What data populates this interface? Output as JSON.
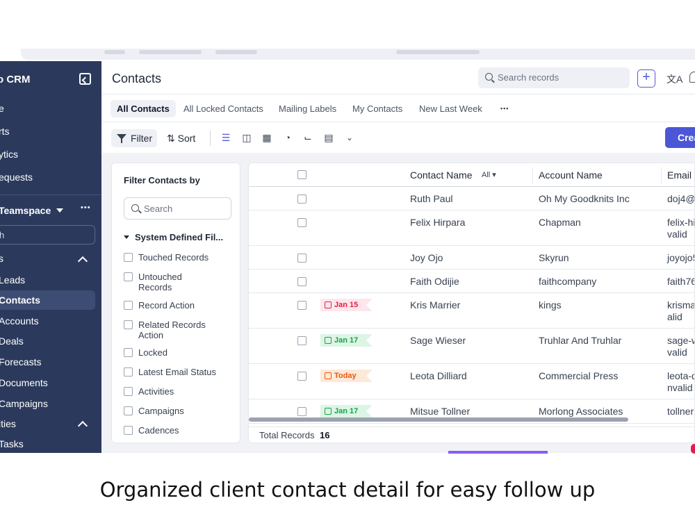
{
  "sidebar": {
    "brand": "o CRM",
    "items": [
      {
        "label": "e"
      },
      {
        "label": "rts"
      },
      {
        "label": "ytics"
      },
      {
        "label": "equests"
      },
      {
        "label": "Teamspace"
      },
      {
        "label": "s"
      },
      {
        "label": "Leads"
      },
      {
        "label": "Contacts"
      },
      {
        "label": "Accounts"
      },
      {
        "label": "Deals"
      },
      {
        "label": "Forecasts"
      },
      {
        "label": "Documents"
      },
      {
        "label": "Campaigns"
      },
      {
        "label": "ities"
      },
      {
        "label": "Tasks"
      }
    ],
    "search_text": "h",
    "more": "•••"
  },
  "header": {
    "title": "Contacts",
    "search_placeholder": "Search records",
    "add_label": "+",
    "translate_label": "文A"
  },
  "tabs": [
    {
      "label": "All Contacts",
      "active": true
    },
    {
      "label": "All Locked Contacts"
    },
    {
      "label": "Mailing Labels"
    },
    {
      "label": "My Contacts"
    },
    {
      "label": "New Last Week"
    }
  ],
  "tabs_more": "•••",
  "toolbar": {
    "filter_label": "Filter",
    "sort_label": "⇅ Sort",
    "create_label": "Crea"
  },
  "filter_panel": {
    "title": "Filter Contacts by",
    "search_placeholder": "Search",
    "section_title": "System Defined Fil...",
    "options": [
      "Touched Records",
      "Untouched Records",
      "Record Action",
      "Related Records Action",
      "Locked",
      "Latest Email Status",
      "Activities",
      "Campaigns",
      "Cadences"
    ]
  },
  "table": {
    "columns": [
      "Contact Name",
      "Account Name",
      "Email"
    ],
    "contact_filter": "All ▾",
    "rows": [
      {
        "tag": "",
        "tag_type": "",
        "name": "Ruth Paul",
        "account": "Oh My Goodknits Inc",
        "email": "doj4@"
      },
      {
        "tag": "",
        "tag_type": "",
        "name": "Felix Hirpara",
        "account": "Chapman",
        "email": "felix-hi",
        "email2": "valid"
      },
      {
        "tag": "",
        "tag_type": "",
        "name": "Joy Ojo",
        "account": "Skyrun",
        "email": "joyojo5"
      },
      {
        "tag": "",
        "tag_type": "",
        "name": "Faith Odijie",
        "account": "faithcompany",
        "email": "faith76"
      },
      {
        "tag": "Jan 15",
        "tag_type": "overdue",
        "name": "Kris Marrier",
        "account": "kings",
        "email": "krisma",
        "email2": "alid"
      },
      {
        "tag": "Jan 17",
        "tag_type": "upcoming",
        "name": "Sage Wieser",
        "account": "Truhlar And Truhlar",
        "email": "sage-w",
        "email2": "valid"
      },
      {
        "tag": "Today",
        "tag_type": "today",
        "name": "Leota Dilliard",
        "account": "Commercial Press",
        "email": "leota-d",
        "email2": "nvalid"
      },
      {
        "tag": "Jan 17",
        "tag_type": "upcoming",
        "name": "Mitsue Tollner",
        "account": "Morlong Associates",
        "email": "tollner"
      }
    ],
    "total_label": "Total Records",
    "total_count": "16"
  },
  "colors": {
    "sidebar_bg": "#2b3a5c",
    "accent": "#4b57d6",
    "tag_overdue": "#e11d48",
    "tag_upcoming": "#16a34a",
    "tag_today": "#ea580c"
  },
  "caption": "Organized client contact detail for easy follow up"
}
